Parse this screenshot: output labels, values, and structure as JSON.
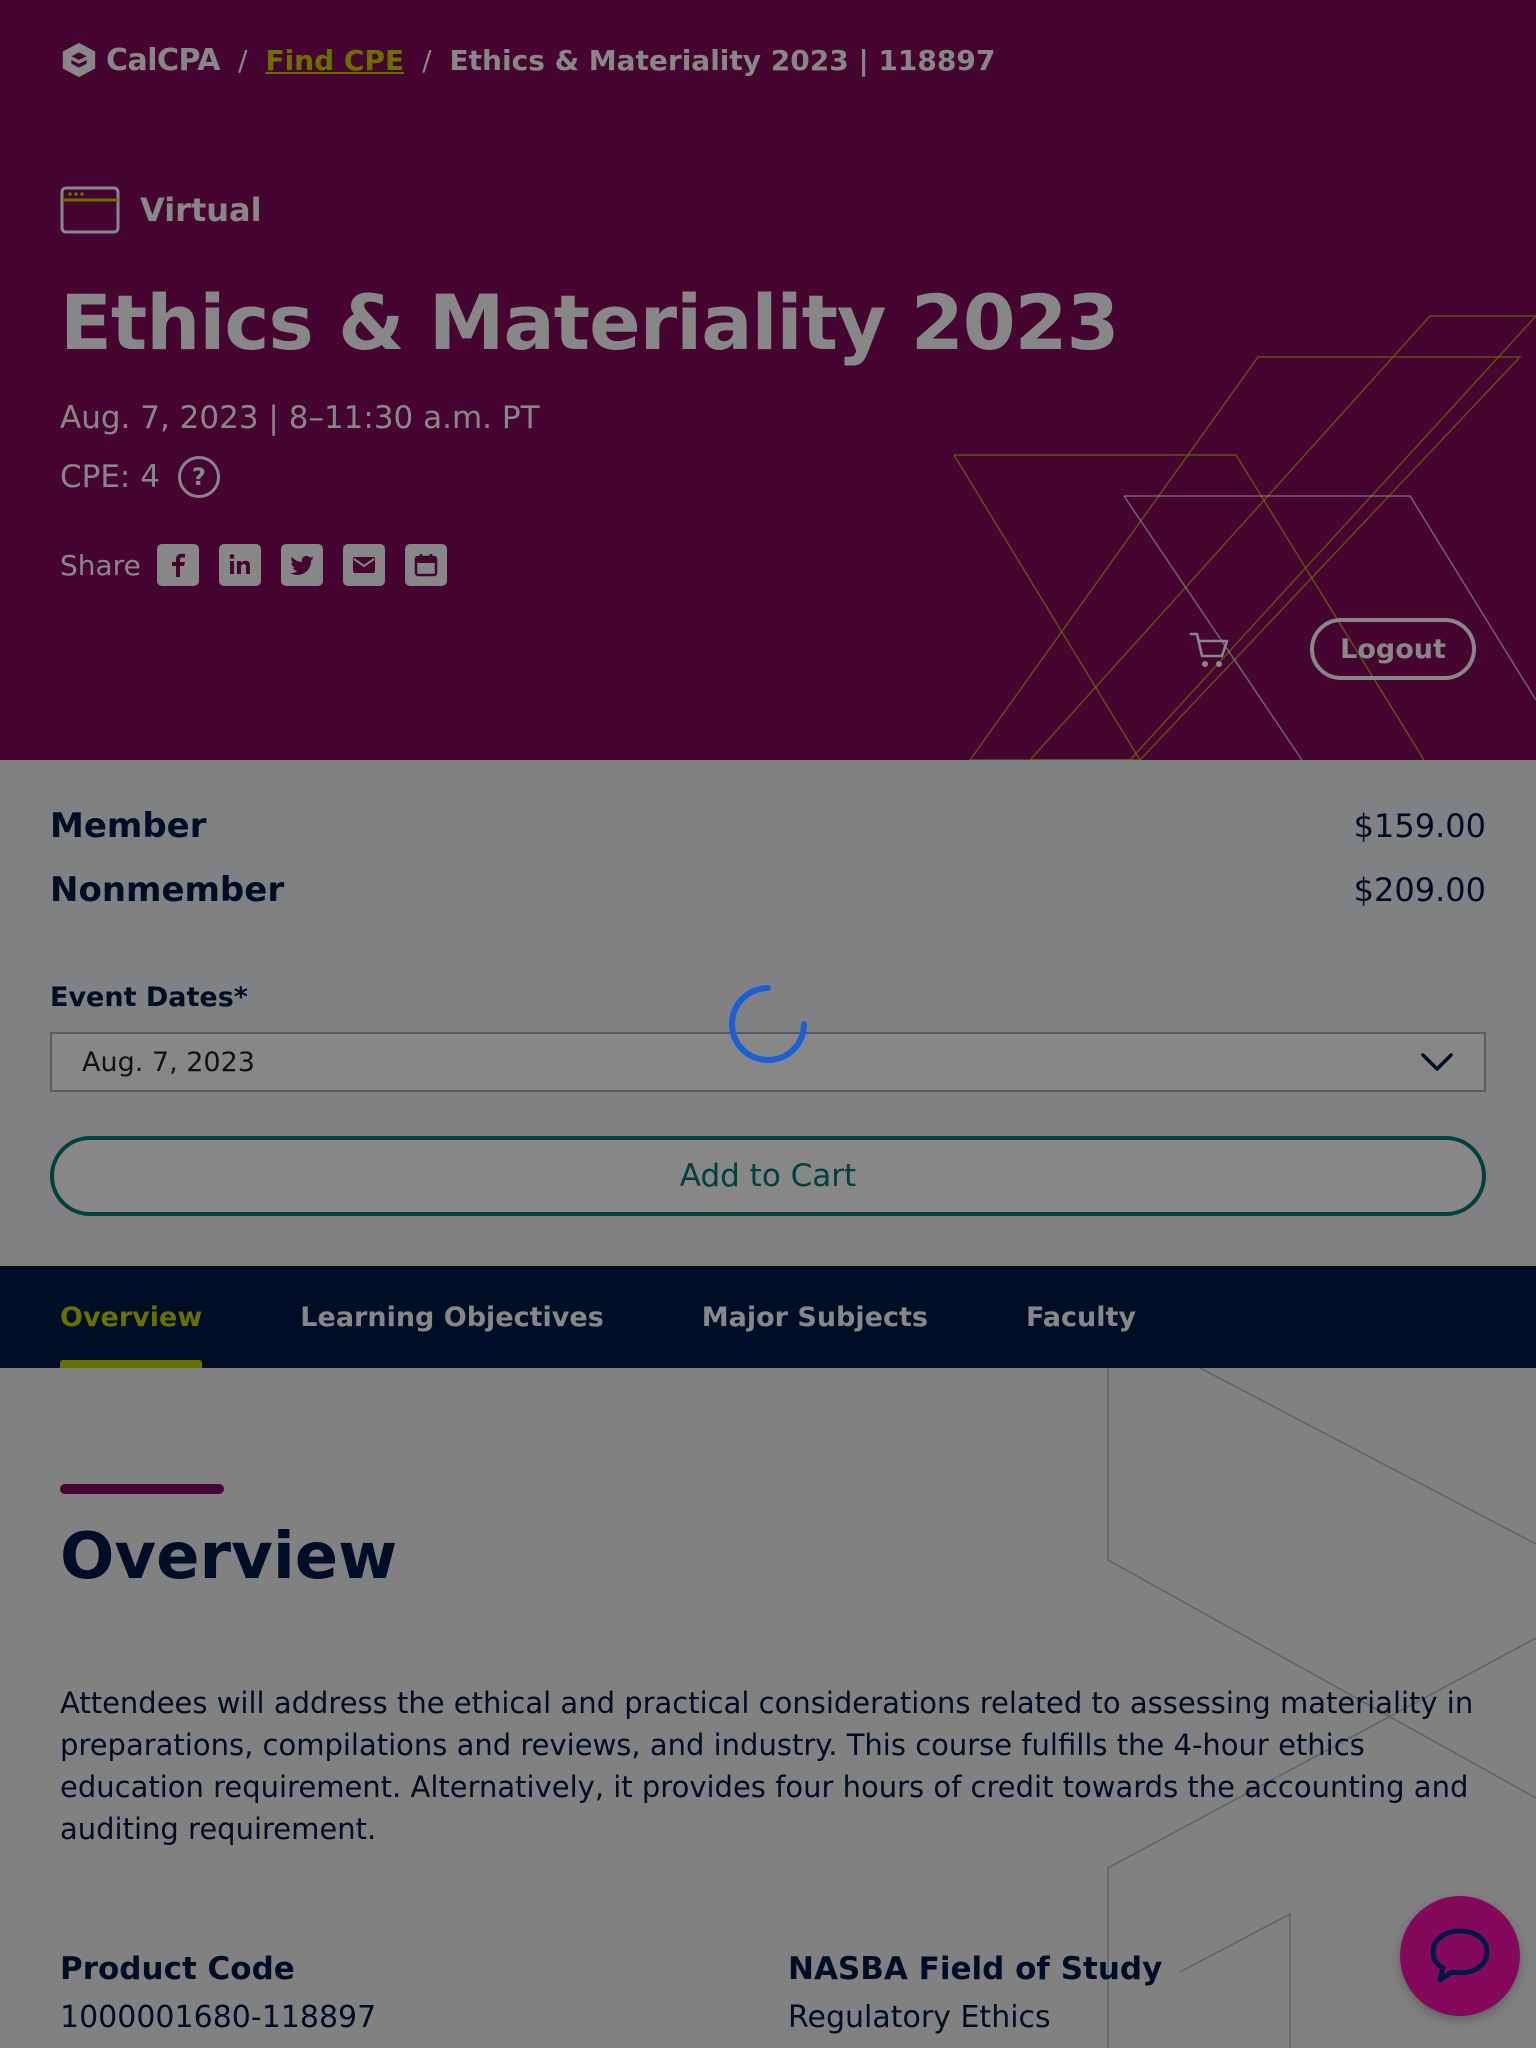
{
  "breadcrumb": {
    "logo_text": "CalCPA",
    "separator": "/",
    "link_label": "Find CPE",
    "current": "Ethics & Materiality 2023 | 118897"
  },
  "hero": {
    "format_label": "Virtual",
    "title": "Ethics & Materiality 2023",
    "date_time": "Aug. 7, 2023 | 8–11:30 a.m. PT",
    "cpe": "CPE: 4",
    "help_glyph": "?",
    "share_label": "Share",
    "share_icons": [
      "facebook-icon",
      "linkedin-icon",
      "twitter-icon",
      "email-icon",
      "calendar-icon"
    ],
    "logout_label": "Logout"
  },
  "pricing": {
    "member_label": "Member",
    "member_price": "$159.00",
    "nonmember_label": "Nonmember",
    "nonmember_price": "$209.00",
    "event_dates_label": "Event Dates*",
    "selected_date": "Aug. 7, 2023",
    "add_to_cart_label": "Add to Cart"
  },
  "tabs": [
    {
      "label": "Overview",
      "active": true
    },
    {
      "label": "Learning Objectives",
      "active": false
    },
    {
      "label": "Major Subjects",
      "active": false
    },
    {
      "label": "Faculty",
      "active": false
    }
  ],
  "overview": {
    "title": "Overview",
    "description": "Attendees will address the ethical and practical considerations related to assessing materiality in preparations, compilations and reviews, and industry. This course fulfills the 4-hour ethics education requirement. Alternatively, it provides four hours of credit towards the accounting and auditing requirement.",
    "product_code_label": "Product Code",
    "product_code": "1000001680-118897",
    "field_of_study_label": "NASBA Field of Study",
    "field_of_study": "Regulatory Ethics"
  },
  "colors": {
    "hero_bg": "#84095c",
    "accent_lime": "#c9d400",
    "navy": "#001a48",
    "teal": "#007c79",
    "spinner_blue": "#1a5fd6",
    "overlay": "rgba(0,0,0,0.47)"
  }
}
